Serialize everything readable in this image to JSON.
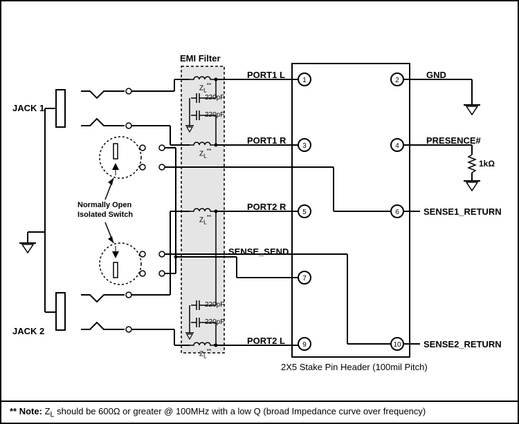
{
  "jacks": {
    "jack1": "JACK 1",
    "jack2": "JACK 2"
  },
  "emi_filter": {
    "title": "EMI Filter",
    "zl1": "Z",
    "zl1sub": "L",
    "zl1sup": "**",
    "cap1": "220pF",
    "cap2": "220pF",
    "zl2": "Z",
    "zl2sub": "L",
    "zl2sup": "**",
    "zl3": "Z",
    "zl3sub": "L",
    "zl3sup": "**",
    "cap3": "220pF",
    "cap4": "220pF",
    "zl4": "Z",
    "zl4sub": "L",
    "zl4sup": "**"
  },
  "switch_note": {
    "line1": "Normally Open",
    "line2": "Isolated Switch"
  },
  "ports": {
    "p1l": "PORT1 L",
    "p1r": "PORT1 R",
    "p2r": "PORT2 R",
    "sense_send": "SENSE_SEND",
    "p2l": "PORT2 L"
  },
  "pins": {
    "n1": "1",
    "n2": "2",
    "n3": "3",
    "n4": "4",
    "n5": "5",
    "n6": "6",
    "n7": "7",
    "n9": "9",
    "n10": "10"
  },
  "right_labels": {
    "gnd": "GND",
    "presence": "PRESENCE#",
    "resistor": "1kΩ",
    "sense1": "SENSE1_RETURN",
    "sense2": "SENSE2_RETURN"
  },
  "header_caption": "2X5 Stake Pin Header (100mil Pitch)",
  "footnote": {
    "prefix": "** Note:  ",
    "zl": "Z",
    "zlsub": "L",
    "text": " should be 600Ω or greater @ 100MHz with a low Q (broad Impedance curve over frequency)"
  }
}
